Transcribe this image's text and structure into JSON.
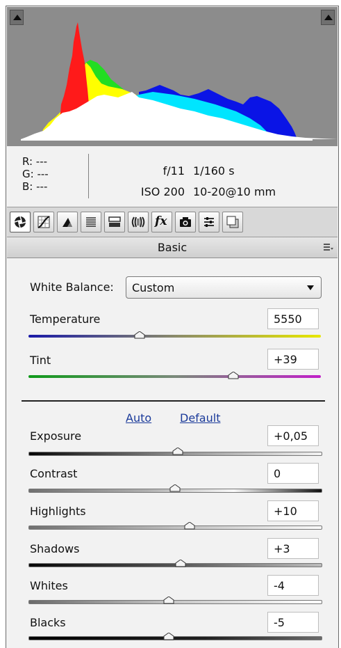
{
  "histogram": {
    "colors": {
      "red": "#ff1a1a",
      "yellow": "#ffff00",
      "green": "#22dd22",
      "cyan": "#00e5ff",
      "blue": "#0a14e6",
      "white": "#ffffff",
      "background": "#8c8c8c"
    }
  },
  "info": {
    "r_label": "R:",
    "r_value": "---",
    "g_label": "G:",
    "g_value": "---",
    "b_label": "B:",
    "b_value": "---",
    "aperture": "f/11",
    "shutter": "1/160 s",
    "iso": "ISO 200",
    "lens": "10-20@10 mm"
  },
  "tabs": {
    "items": [
      {
        "icon": "aperture-icon",
        "active": true
      },
      {
        "icon": "tone-curve-icon"
      },
      {
        "icon": "detail-triangle-icon"
      },
      {
        "icon": "hsl-lines-icon"
      },
      {
        "icon": "split-toning-icon"
      },
      {
        "icon": "lens-corrections-icon"
      },
      {
        "icon": "fx-icon",
        "text": "fx"
      },
      {
        "icon": "camera-calibration-icon"
      },
      {
        "icon": "presets-sliders-icon"
      },
      {
        "icon": "snapshots-icon"
      }
    ]
  },
  "panel": {
    "title": "Basic",
    "white_balance_label": "White Balance:",
    "white_balance_value": "Custom",
    "auto_label": "Auto",
    "default_label": "Default"
  },
  "controls": {
    "temperature": {
      "label": "Temperature",
      "value": "5550",
      "position": 0.38
    },
    "tint": {
      "label": "Tint",
      "value": "+39",
      "position": 0.7
    },
    "exposure": {
      "label": "Exposure",
      "value": "+0,05",
      "position": 0.51
    },
    "contrast": {
      "label": "Contrast",
      "value": "0",
      "position": 0.5
    },
    "highlights": {
      "label": "Highlights",
      "value": "+10",
      "position": 0.55
    },
    "shadows": {
      "label": "Shadows",
      "value": "+3",
      "position": 0.52
    },
    "whites": {
      "label": "Whites",
      "value": "-4",
      "position": 0.48
    },
    "blacks": {
      "label": "Blacks",
      "value": "-5",
      "position": 0.48
    }
  }
}
